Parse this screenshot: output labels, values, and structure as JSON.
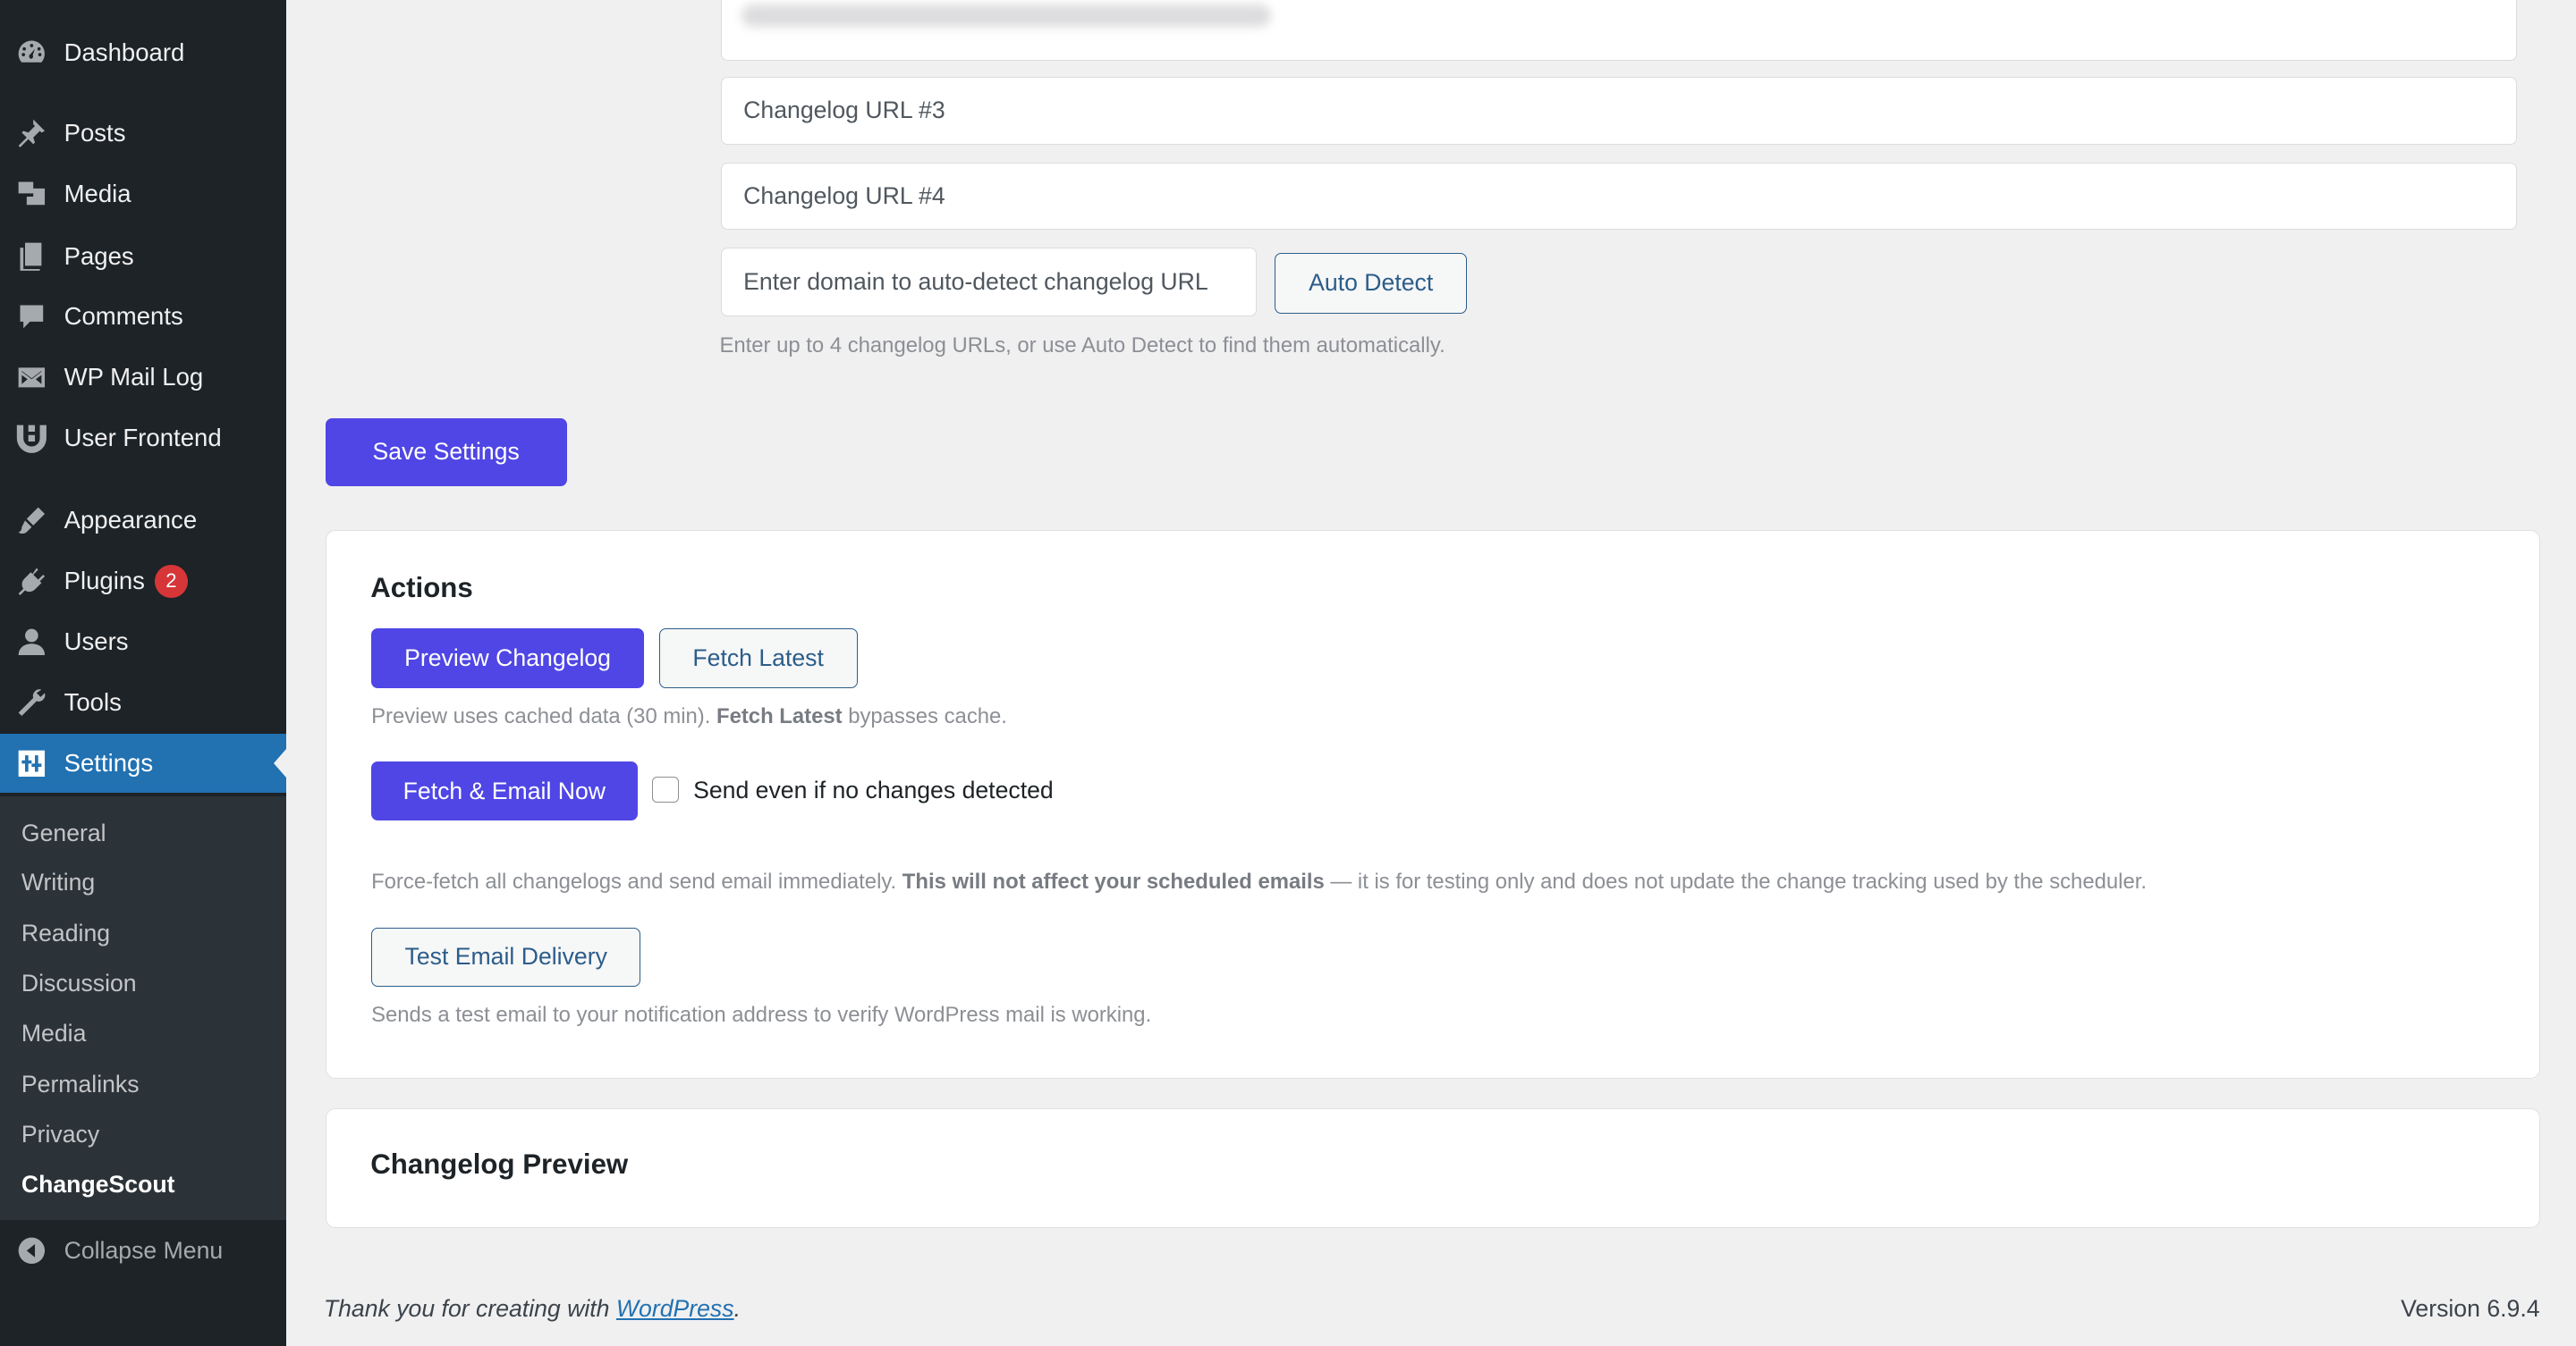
{
  "sidebar": {
    "menu": [
      {
        "label": "Dashboard",
        "icon": "dashboard-icon"
      },
      {
        "label": "Posts",
        "icon": "pin-icon"
      },
      {
        "label": "Media",
        "icon": "media-icon"
      },
      {
        "label": "Pages",
        "icon": "pages-icon"
      },
      {
        "label": "Comments",
        "icon": "comment-icon"
      },
      {
        "label": "WP Mail Log",
        "icon": "mail-icon"
      },
      {
        "label": "User Frontend",
        "icon": "user-frontend-icon"
      },
      {
        "label": "Appearance",
        "icon": "brush-icon"
      },
      {
        "label": "Plugins",
        "icon": "plugin-icon",
        "badge": "2"
      },
      {
        "label": "Users",
        "icon": "user-icon"
      },
      {
        "label": "Tools",
        "icon": "wrench-icon"
      },
      {
        "label": "Settings",
        "icon": "settings-icon"
      }
    ],
    "submenu": [
      "General",
      "Writing",
      "Reading",
      "Discussion",
      "Media",
      "Permalinks",
      "Privacy",
      "ChangeScout"
    ],
    "collapse_label": "Collapse Menu"
  },
  "form": {
    "url3_placeholder": "Changelog URL #3",
    "url4_placeholder": "Changelog URL #4",
    "domain_placeholder": "Enter domain to auto-detect changelog URL",
    "auto_detect_label": "Auto Detect",
    "help_text": "Enter up to 4 changelog URLs, or use Auto Detect to find them automatically.",
    "save_label": "Save Settings"
  },
  "actions": {
    "title": "Actions",
    "preview_label": "Preview Changelog",
    "fetch_latest_label": "Fetch Latest",
    "preview_help_1": "Preview uses cached data (30 min). ",
    "preview_help_bold": "Fetch Latest",
    "preview_help_2": " bypasses cache.",
    "fetch_email_label": "Fetch & Email Now",
    "send_even_label": "Send even if no changes detected",
    "force_help_1": "Force-fetch all changelogs and send email immediately. ",
    "force_help_bold": "This will not affect your scheduled emails",
    "force_help_2": " — it is for testing only and does not update the change tracking used by the scheduler.",
    "test_email_label": "Test Email Delivery",
    "test_help": "Sends a test email to your notification address to verify WordPress mail is working."
  },
  "preview_card": {
    "title": "Changelog Preview"
  },
  "footer": {
    "thanks_prefix": "Thank you for creating with ",
    "wp_link": "WordPress",
    "thanks_suffix": ".",
    "version": "Version 6.9.4"
  },
  "colors": {
    "sidebar": "#1d2327",
    "active": "#2271b1",
    "primary": "#4f46e5",
    "badge": "#d63638"
  }
}
